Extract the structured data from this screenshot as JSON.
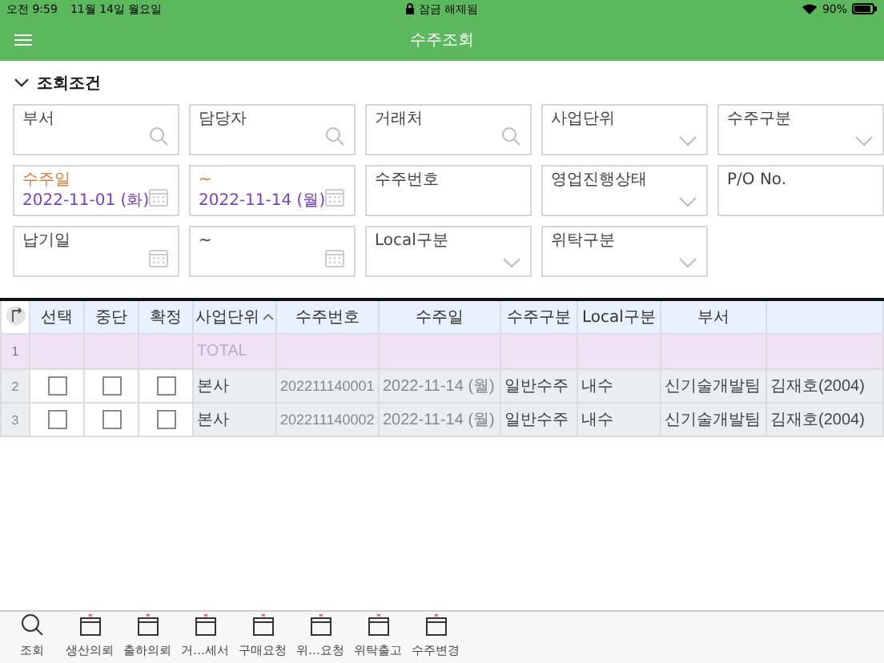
{
  "status_bar": {
    "time": "오전 9:59",
    "date": "11월 14일 월요일",
    "lock_text": "잠금 해제됨",
    "battery": "90%"
  },
  "header": {
    "title": "수주조회"
  },
  "section": {
    "title": "조회조건",
    "expanded": true
  },
  "filters": [
    {
      "label": "부서",
      "kind": "search",
      "required": false
    },
    {
      "label": "담당자",
      "kind": "search",
      "required": false
    },
    {
      "label": "거래처",
      "kind": "search",
      "required": false
    },
    {
      "label": "사업단위",
      "kind": "dropdown",
      "required": false
    },
    {
      "label": "수주구분",
      "kind": "dropdown",
      "required": false
    },
    {
      "label": "수주일",
      "kind": "date",
      "required": true,
      "value": "2022-11-01 (화)"
    },
    {
      "label": "~",
      "kind": "date",
      "required": true,
      "value": "2022-11-14 (월)"
    },
    {
      "label": "수주번호",
      "kind": "text",
      "required": false
    },
    {
      "label": "영업진행상태",
      "kind": "dropdown",
      "required": false
    },
    {
      "label": "P/O No.",
      "kind": "text",
      "required": false
    },
    {
      "label": "납기일",
      "kind": "date",
      "required": false
    },
    {
      "label": "~",
      "kind": "date",
      "required": false
    },
    {
      "label": "Local구분",
      "kind": "dropdown",
      "required": false
    },
    {
      "label": "위탁구분",
      "kind": "dropdown",
      "required": false
    }
  ],
  "table": {
    "check_columns": [
      "선택",
      "중단",
      "확정"
    ],
    "columns": [
      {
        "label": "사업단위",
        "sorted": true
      },
      {
        "label": "수주번호",
        "sorted": false
      },
      {
        "label": "수주일",
        "sorted": false
      },
      {
        "label": "수주구분",
        "sorted": false
      },
      {
        "label": "Local구분",
        "sorted": false
      },
      {
        "label": "부서",
        "sorted": false
      }
    ],
    "total_row": {
      "number": "1",
      "cells": [
        "TOTAL"
      ]
    },
    "rows": [
      {
        "number": "2",
        "checks": [
          false,
          false,
          false
        ],
        "cells": [
          "본사",
          "202211140001",
          "2022-11-14 (월)",
          "일반수주",
          "내수",
          "신기술개발팀",
          "김재호(2004)"
        ]
      },
      {
        "number": "3",
        "checks": [
          false,
          false,
          false
        ],
        "cells": [
          "본사",
          "202211140002",
          "2022-11-14 (월)",
          "일반수주",
          "내수",
          "신기술개발팀",
          "김재호(2004)"
        ]
      }
    ]
  },
  "toolbar": [
    {
      "label": "조회",
      "kind": "search"
    },
    {
      "label": "생산의뢰",
      "kind": "form"
    },
    {
      "label": "출하의뢰",
      "kind": "form"
    },
    {
      "label": "거…세서",
      "kind": "form"
    },
    {
      "label": "구매요청",
      "kind": "form"
    },
    {
      "label": "위…요청",
      "kind": "form"
    },
    {
      "label": "위탁출고",
      "kind": "form"
    },
    {
      "label": "수주변경",
      "kind": "form"
    }
  ]
}
